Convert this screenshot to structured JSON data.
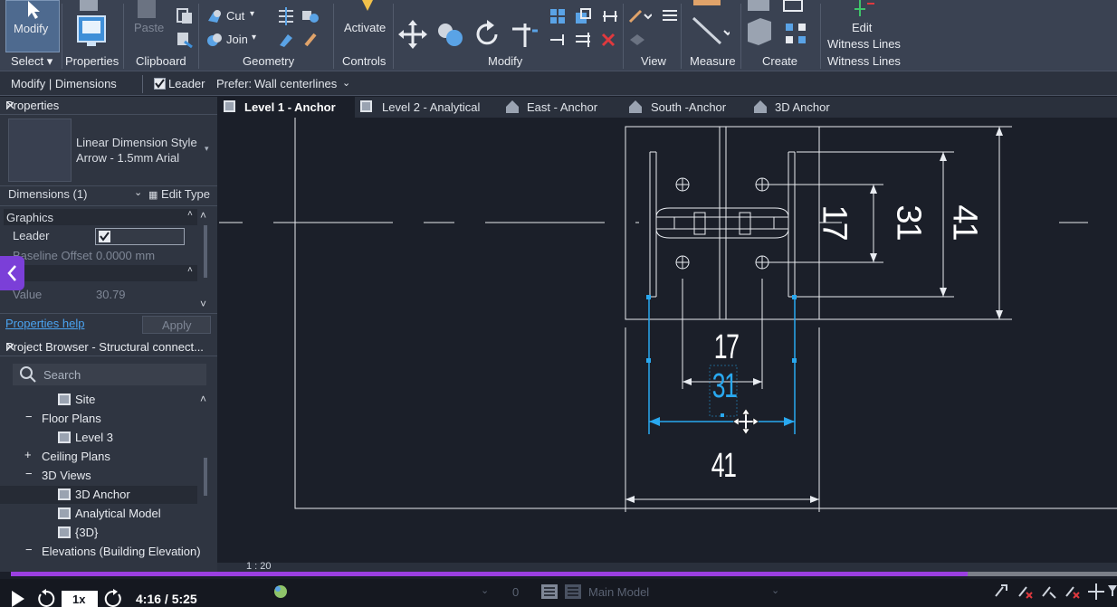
{
  "ribbon": {
    "modify_label": "Modify",
    "select_label": "Select",
    "properties_label": "Properties",
    "paste_label": "Paste",
    "clipboard_label": "Clipboard",
    "cut_label": "Cut",
    "join_label": "Join",
    "geometry_label": "Geometry",
    "activate_label": "Activate",
    "controls_label": "Controls",
    "modify_group_label": "Modify",
    "view_label": "View",
    "measure_label": "Measure",
    "create_label": "Create",
    "edit_label": "Edit",
    "witness_lines_label": "Witness Lines",
    "witness_lines_group": "Witness Lines"
  },
  "options_bar": {
    "context": "Modify | Dimensions",
    "leader_label": "Leader",
    "prefer_label": "Prefer:",
    "prefer_value": "Wall centerlines"
  },
  "properties": {
    "title": "Properties",
    "type_line1": "Linear Dimension Style",
    "type_line2": "Arrow - 1.5mm Arial",
    "filter_value": "Dimensions (1)",
    "edit_type": "Edit Type",
    "section_graphics": "Graphics",
    "leader_label": "Leader",
    "baseline_label": "Baseline Offset",
    "baseline_value": "0.0000 mm",
    "value_label": "Value",
    "value_value": "30.79",
    "help_link": "Properties help",
    "apply_label": "Apply"
  },
  "browser": {
    "title": "Project Browser - Structural connect...",
    "search_placeholder": "Search",
    "items": [
      {
        "label": "Site",
        "kind": "view"
      },
      {
        "label": "Floor Plans",
        "kind": "group-open"
      },
      {
        "label": "Level 3",
        "kind": "view"
      },
      {
        "label": "Ceiling Plans",
        "kind": "group-closed"
      },
      {
        "label": "3D Views",
        "kind": "group-open"
      },
      {
        "label": "3D Anchor",
        "kind": "view"
      },
      {
        "label": "Analytical Model",
        "kind": "view"
      },
      {
        "label": "{3D}",
        "kind": "view"
      },
      {
        "label": "Elevations (Building Elevation)",
        "kind": "group-open"
      }
    ]
  },
  "tabs": [
    {
      "label": "Level 1 - Anchor",
      "active": true
    },
    {
      "label": "Level 2 - Analytical",
      "active": false
    },
    {
      "label": "East - Anchor",
      "active": false
    },
    {
      "label": "South -Anchor",
      "active": false
    },
    {
      "label": "3D Anchor",
      "active": false
    }
  ],
  "drawing": {
    "dim_17_right": "17",
    "dim_31_right": "31",
    "dim_41_right": "41",
    "dim_17_bottom": "17",
    "dim_31_bottom": "31",
    "dim_41_bottom": "41"
  },
  "viewbar": {
    "scale": "1 : 20"
  },
  "player": {
    "speed": "1x",
    "time": "4:16 / 5:25",
    "progress": 0.865,
    "model": "Main Model",
    "zero": "0"
  },
  "colors": {
    "accent": "#9b3fe0",
    "selection": "#29a8ef",
    "canvas": "#1b1f29"
  }
}
